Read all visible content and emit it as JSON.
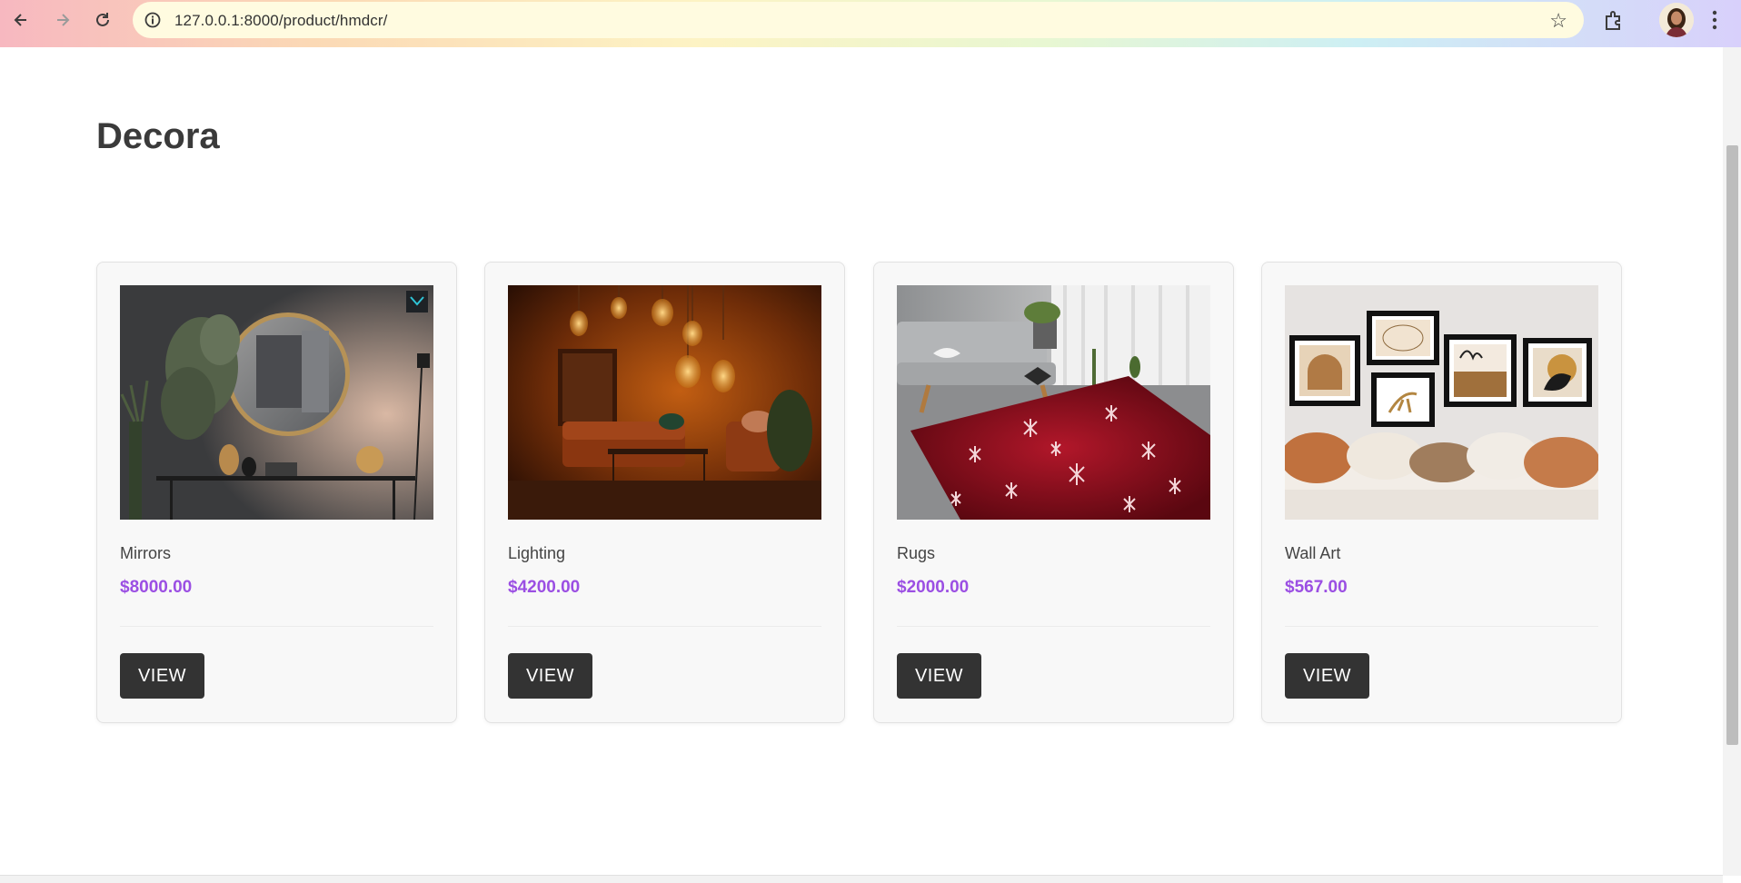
{
  "browser": {
    "url": "127.0.0.1:8000/product/hmdcr/"
  },
  "page": {
    "title": "Decora"
  },
  "products": [
    {
      "name": "Mirrors",
      "price": "$8000.00",
      "button": "VIEW",
      "image": "mirror-room-image"
    },
    {
      "name": "Lighting",
      "price": "$4200.00",
      "button": "VIEW",
      "image": "pendant-lights-room-image"
    },
    {
      "name": "Rugs",
      "price": "$2000.00",
      "button": "VIEW",
      "image": "snowflake-rug-image"
    },
    {
      "name": "Wall Art",
      "price": "$567.00",
      "button": "VIEW",
      "image": "framed-wall-art-image"
    }
  ],
  "colors": {
    "price": "#9b4fe3",
    "button": "#333333",
    "title": "#3a3a3a"
  }
}
